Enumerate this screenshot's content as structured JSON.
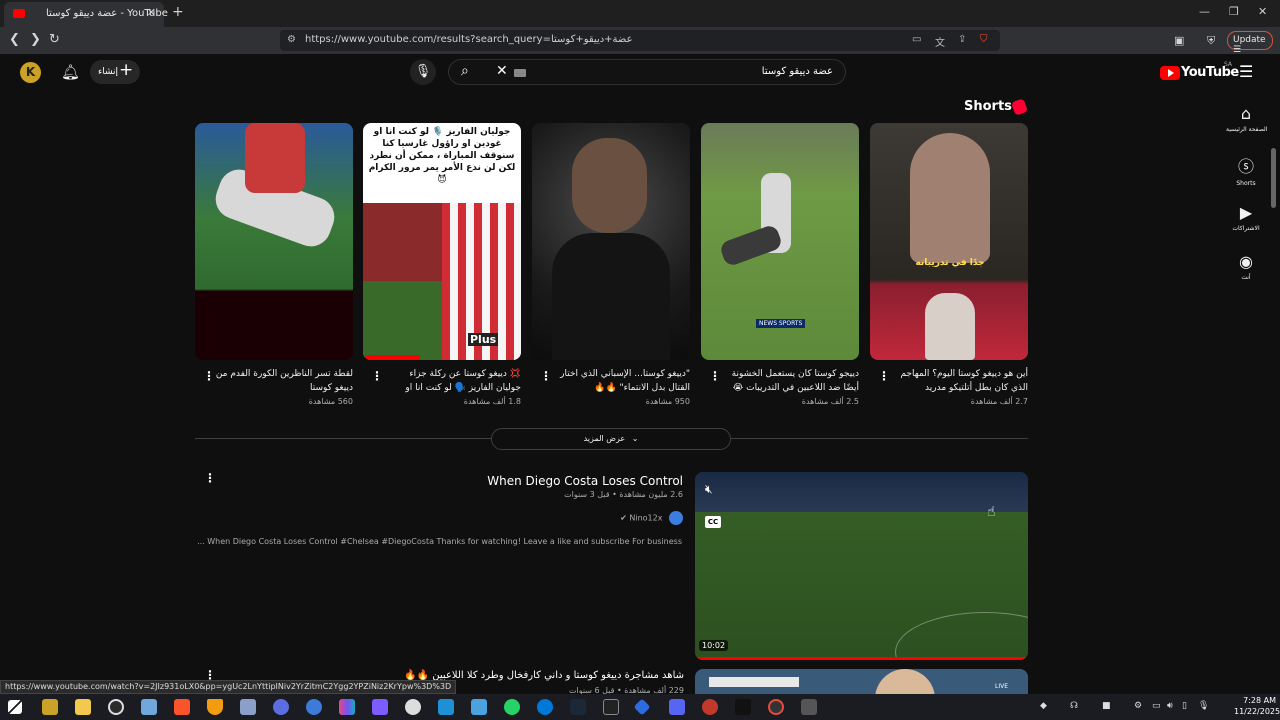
{
  "browser": {
    "tab_title": "عضة دييقو كوستا - YouTube",
    "url": "https://www.youtube.com/results?search_query=عضة+دييقو+كوستا",
    "update_label": "Update",
    "status_url": "https://www.youtube.com/watch?v=2JIz931oLX0&pp=ygUc2LnYttipINiv2YrZitmC2Ygg2YPZiNiz2KrYpw%3D%3D"
  },
  "header": {
    "avatar_letter": "K",
    "create_label": "إنشاء",
    "search_query": "عضة دييقو كوستا",
    "logo_text": "YouTube",
    "country_code": "SA"
  },
  "sidebar": {
    "items": [
      {
        "label": "الصفحة الرئيسية",
        "icon": "home-icon"
      },
      {
        "label": "Shorts",
        "icon": "shorts-icon"
      },
      {
        "label": "الاشتراكات",
        "icon": "subscriptions-icon"
      },
      {
        "label": "أنت",
        "icon": "you-icon"
      }
    ]
  },
  "shorts": {
    "heading": "Shorts",
    "items": [
      {
        "title": "أين هو دييغو كوستا اليوم؟ المهاجم الذي كان بطل أتلتيكو مدريد وتشيلسي وكان...",
        "views": "2.7 ألف مشاهدة",
        "caption": "جدًا في تدريباته",
        "badge": ""
      },
      {
        "title": "دييجو كوستا كان يستعمل الخشونة أيضًا ضد اللاعبين في التدريبات 😭",
        "views": "2.5 ألف مشاهدة",
        "caption": "",
        "badge": "NEWS SPORTS"
      },
      {
        "title": "\"دييغو كوستا... الإسباني الذي اختار القتال بدل الانتماء\" 🔥🔥",
        "views": "950 مشاهدة",
        "caption": "",
        "badge": ""
      },
      {
        "title": "💢 دييغو كوستا عن ركلة جزاء جوليان الفاريز 🗣️ لو كنت انا او غودين او ...",
        "views": "1.8 ألف مشاهدة",
        "caption": "جوليان الفاريز 🎙️ لو كنت انا او غودين او راؤول غارسيا كنا سنوقف المباراة ، ممكن أن نطرد لكن لن ندع الأمر يمر مرور الكرام 😈",
        "badge": "Plus"
      },
      {
        "title": "لقطة تسر الناظرين الكورة الفدم من دييغو كوستا",
        "views": "560 مشاهدة",
        "caption": "",
        "badge": ""
      }
    ]
  },
  "show_more_label": "عرض المزيد",
  "results": [
    {
      "title": "When Diego Costa Loses Control",
      "meta": "2.6 مليون مشاهدة • قبل 3 سنوات",
      "channel": "Nino12x",
      "description": "When Diego Costa Loses Control #Chelsea #DiegoCosta Thanks for watching! Leave a like and subscribe For business ...",
      "duration": "10:02",
      "cc_label": "CC"
    },
    {
      "title": "شاهد مشاجرة دييغو كوستا و داني كارفخال وطرد كلا اللاعبين 🔥🔥",
      "meta": "229 ألف مشاهدة • قبل 6 سنوات",
      "live_label": "LIVE"
    }
  ],
  "taskbar": {
    "time": "7:28 AM",
    "date": "11/22/2025"
  }
}
